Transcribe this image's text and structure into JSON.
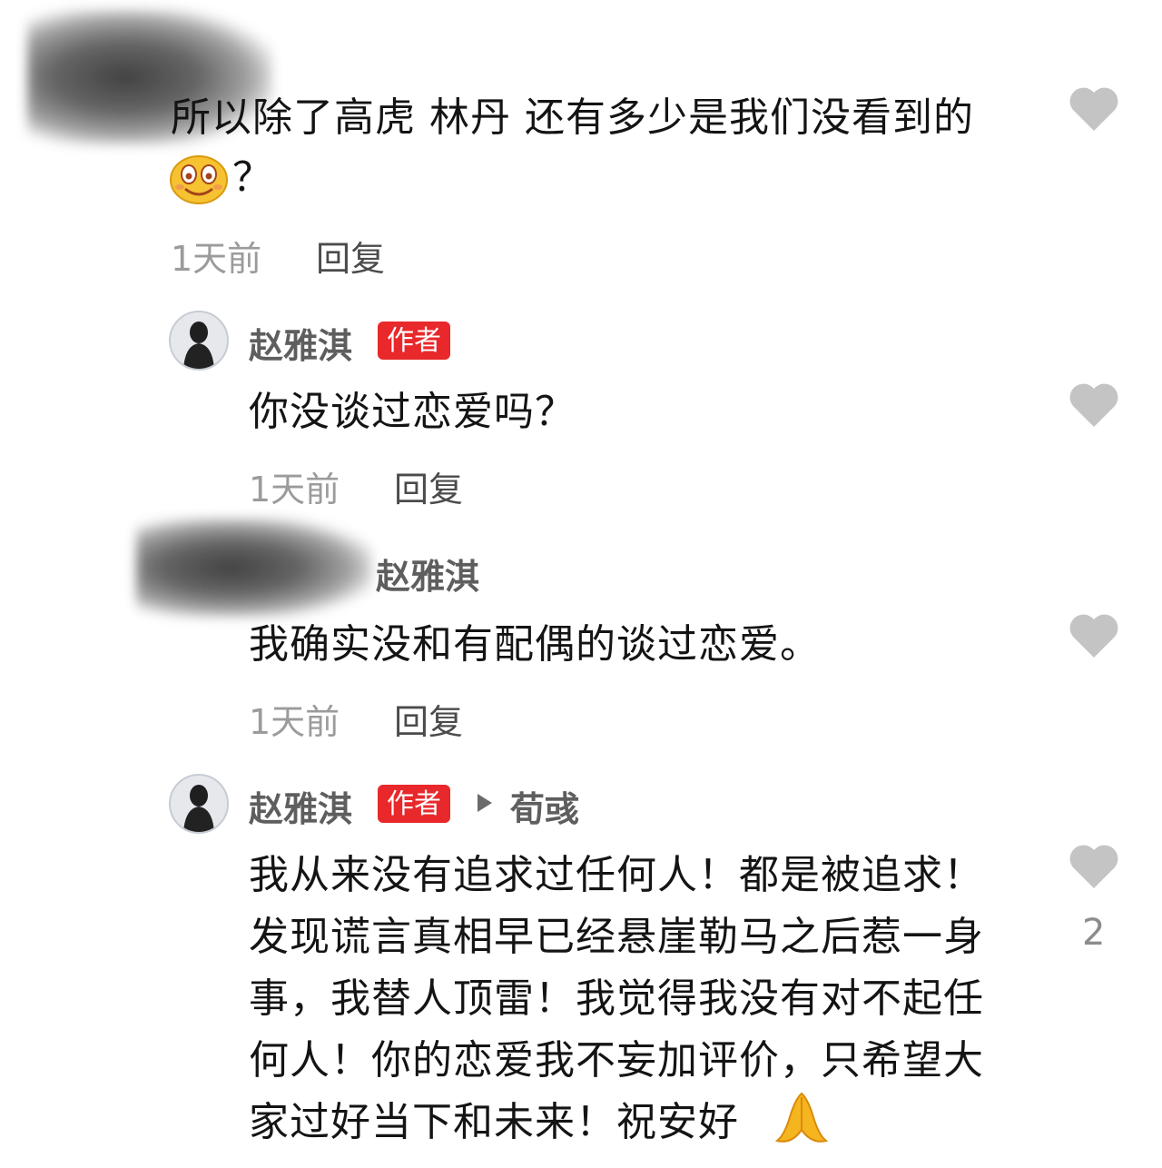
{
  "comments": [
    {
      "text_line1": "所以除了高虎 林丹 还有多少是我们没看到的",
      "text_line2": "？",
      "emoji": "smiley-face",
      "time": "1天前",
      "reply": "回复"
    },
    {
      "username": "赵雅淇",
      "badge": "作者",
      "text": "你没谈过恋爱吗？",
      "time": "1天前",
      "reply": "回复"
    },
    {
      "username": "赵雅淇",
      "text": "我确实没和有配偶的谈过恋爱。",
      "time": "1天前",
      "reply": "回复"
    },
    {
      "username": "赵雅淇",
      "badge": "作者",
      "reply_to": "荀彧",
      "lines": [
        "我从来没有追求过任何人！都是被追求！",
        "发现谎言真相早已经悬崖勒马之后惹一身",
        "事，我替人顶雷！我觉得我没有对不起任",
        "何人！你的恋爱我不妄加评价，只希望大",
        "家过好当下和未来！祝安好"
      ],
      "emoji": "praying-hands",
      "like_count": "2"
    }
  ],
  "colors": {
    "badge": "#e8282b",
    "heart": "#c4c4c4",
    "meta": "#9b9b9b"
  }
}
